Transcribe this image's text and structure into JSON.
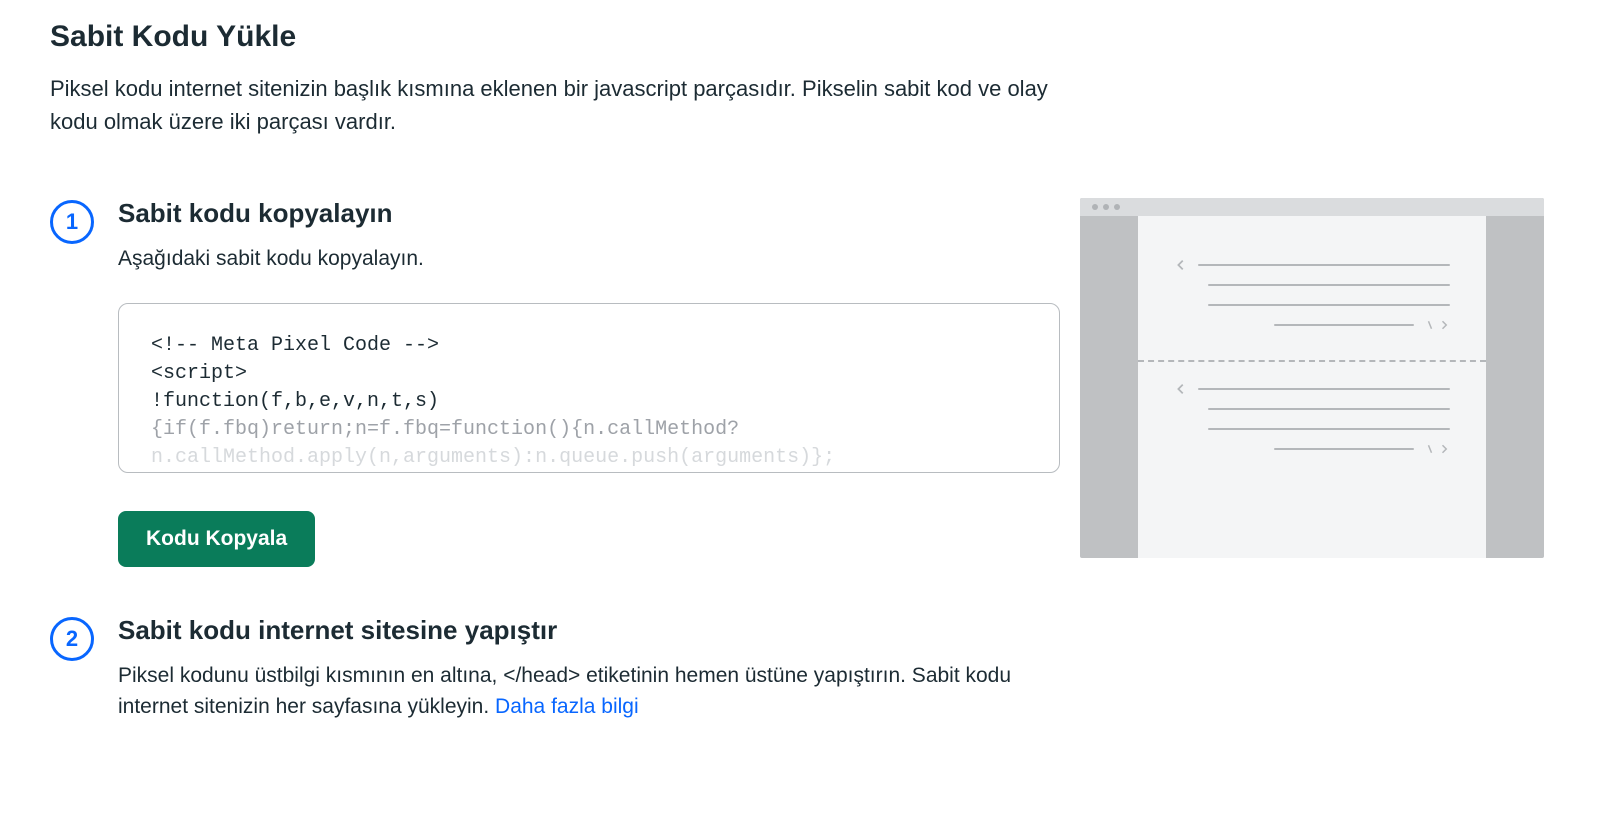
{
  "header": {
    "title": "Sabit Kodu Yükle",
    "description": "Piksel kodu internet sitenizin başlık kısmına eklenen bir javascript parçasıdır. Pikselin sabit kod ve olay kodu olmak üzere iki parçası vardır."
  },
  "steps": {
    "s1": {
      "number": "1",
      "title": "Sabit kodu kopyalayın",
      "subtitle": "Aşağıdaki sabit kodu kopyalayın.",
      "code": {
        "l1": "<!-- Meta Pixel Code -->",
        "l2": "<script>",
        "l3": "!function(f,b,e,v,n,t,s)",
        "l4": "{if(f.fbq)return;n=f.fbq=function(){n.callMethod?",
        "l5": "n.callMethod.apply(n,arguments):n.queue.push(arguments)};"
      },
      "copy_button": "Kodu Kopyala"
    },
    "s2": {
      "number": "2",
      "title": "Sabit kodu internet sitesine yapıştır",
      "subtitle_prefix": "Piksel kodunu üstbilgi kısmının en altına, </head> etiketinin hemen üstüne yapıştırın. Sabit kodu internet sitenizin her sayfasına yükleyin. ",
      "link_text": "Daha fazla bilgi"
    }
  }
}
